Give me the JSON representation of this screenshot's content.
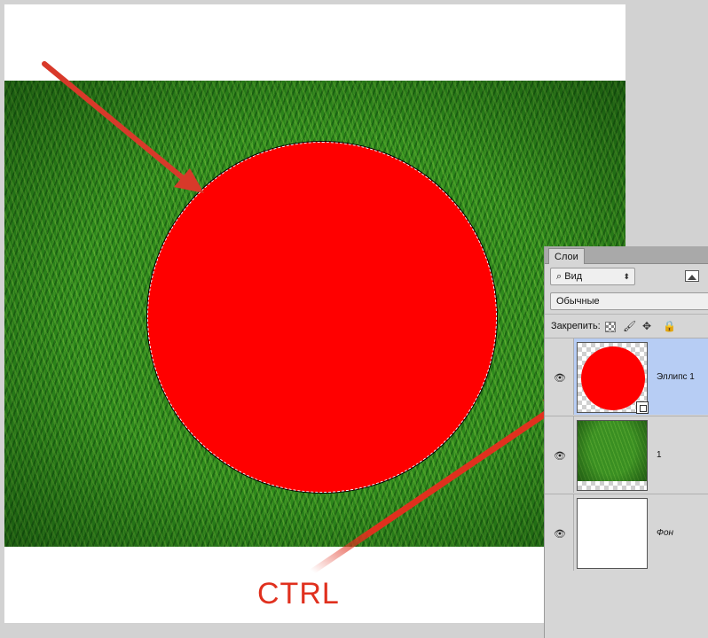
{
  "annotation": {
    "ctrl_label": "CTRL",
    "arrow_color": "#e0301e"
  },
  "canvas": {
    "background_color": "#ffffff",
    "shape_color": "#ff0000",
    "photo_description": "grass"
  },
  "layers_panel": {
    "tab_label": "Слои",
    "filter_label": "Вид",
    "filter_icon": "search-icon",
    "blend_mode": "Обычные",
    "lock_label": "Закрепить:",
    "lock_icons": [
      "lock-pixels-icon",
      "brush-icon",
      "move-icon",
      "lock-icon"
    ],
    "layers": [
      {
        "name": "Эллипс 1",
        "selected": true,
        "visible": true
      },
      {
        "name": "1",
        "selected": false,
        "visible": true
      },
      {
        "name": "Фон",
        "selected": false,
        "visible": true
      }
    ],
    "selection_color": "#b7cdf4"
  }
}
